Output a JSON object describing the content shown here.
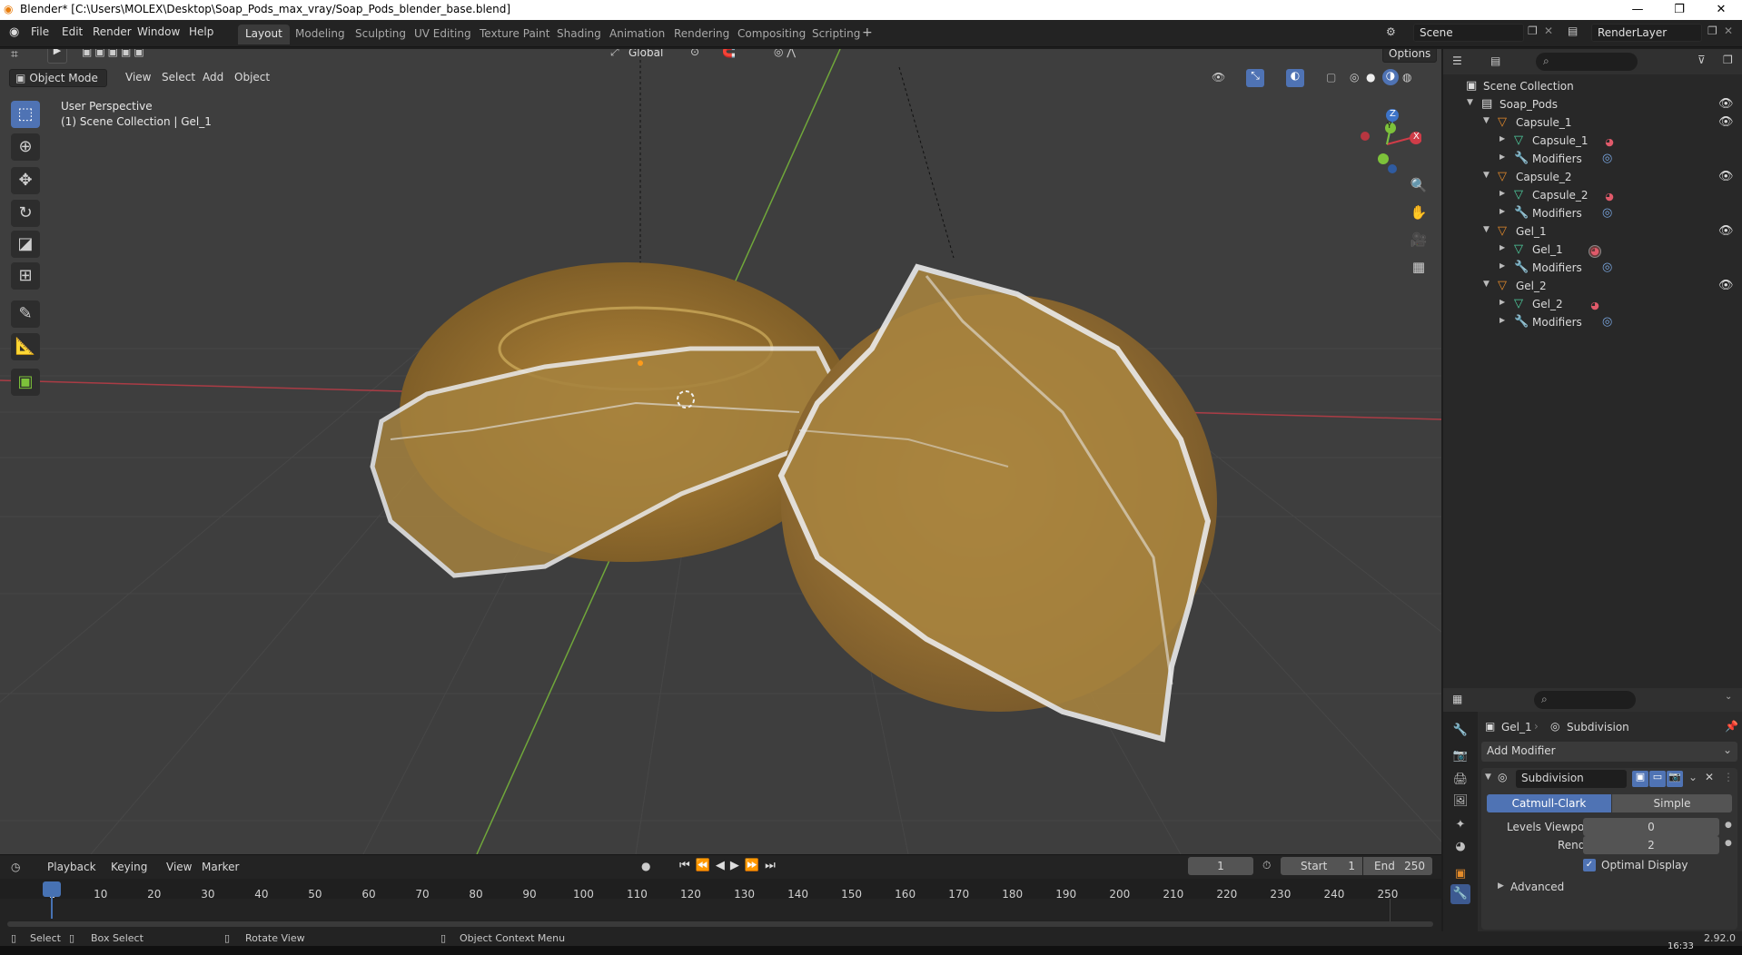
{
  "window": {
    "title": "Blender* [C:\\Users\\MOLEX\\Desktop\\Soap_Pods_max_vray/Soap_Pods_blender_base.blend]",
    "minimize": "—",
    "maximize": "❐",
    "close": "✕"
  },
  "menu": {
    "file": "File",
    "edit": "Edit",
    "render": "Render",
    "window": "Window",
    "help": "Help"
  },
  "workspaces": [
    "Layout",
    "Modeling",
    "Sculpting",
    "UV Editing",
    "Texture Paint",
    "Shading",
    "Animation",
    "Rendering",
    "Compositing",
    "Scripting"
  ],
  "active_workspace": "Layout",
  "scene": {
    "name": "Scene",
    "view_layer": "RenderLayer"
  },
  "viewport": {
    "mode": "Object Mode",
    "menus": {
      "view": "View",
      "select": "Select",
      "add": "Add",
      "object": "Object"
    },
    "transform_orientation": "Global",
    "options": "Options",
    "overlay_title": "User Perspective",
    "overlay_collection": "(1) Scene Collection | Gel_1",
    "gizmo": {
      "z": "Z",
      "y": "Y",
      "x": "X"
    },
    "colors": {
      "x_axis": "#cf3c48",
      "y_axis": "#7dc23a",
      "z_axis": "#3d74c8",
      "bg": "#3e3e3e",
      "object": "#c79a3d"
    }
  },
  "outliner": {
    "root": "Scene Collection",
    "collection": "Soap_Pods",
    "items": [
      {
        "name": "Capsule_1",
        "mesh": "Capsule_1",
        "modifiers": "Modifiers"
      },
      {
        "name": "Capsule_2",
        "mesh": "Capsule_2",
        "modifiers": "Modifiers"
      },
      {
        "name": "Gel_1",
        "mesh": "Gel_1",
        "modifiers": "Modifiers"
      },
      {
        "name": "Gel_2",
        "mesh": "Gel_2",
        "modifiers": "Modifiers"
      }
    ]
  },
  "properties": {
    "object": "Gel_1",
    "modifier_breadcrumb": "Subdivision",
    "add_modifier": "Add Modifier",
    "modifier": {
      "name": "Subdivision",
      "type_a": "Catmull-Clark",
      "type_b": "Simple",
      "levels_viewport_label": "Levels Viewport",
      "levels_viewport": "0",
      "render_label": "Render",
      "render": "2",
      "optimal_display": "Optimal Display",
      "advanced": "Advanced"
    }
  },
  "timeline": {
    "menus": {
      "playback": "Playback",
      "keying": "Keying",
      "view": "View",
      "marker": "Marker"
    },
    "current_frame": "1",
    "start_label": "Start",
    "start": "1",
    "end_label": "End",
    "end": "250",
    "ticks": [
      "1",
      "10",
      "20",
      "30",
      "40",
      "50",
      "60",
      "70",
      "80",
      "90",
      "100",
      "110",
      "120",
      "130",
      "140",
      "150",
      "160",
      "170",
      "180",
      "190",
      "200",
      "210",
      "220",
      "230",
      "240",
      "250"
    ]
  },
  "status": {
    "select": "Select",
    "box_select": "Box Select",
    "rotate_view": "Rotate View",
    "context_menu": "Object Context Menu",
    "version": "2.92.0"
  },
  "taskbar": {
    "time": "16:33"
  }
}
